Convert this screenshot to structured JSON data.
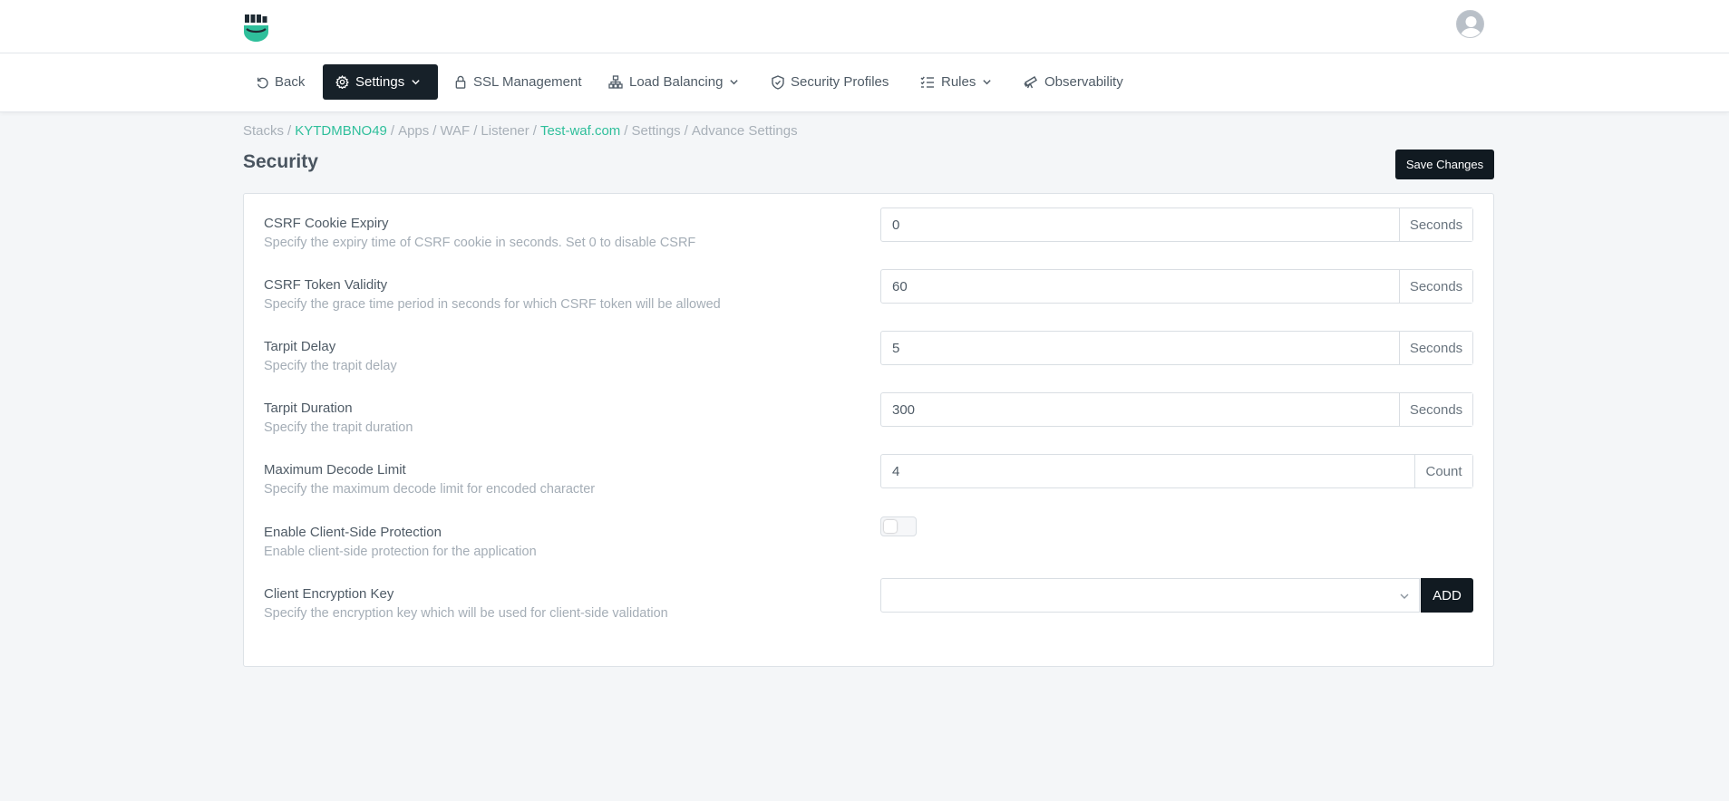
{
  "nav": {
    "items": [
      {
        "label": "Back",
        "icon": "undo-icon"
      },
      {
        "label": "Settings",
        "icon": "gear-icon",
        "active": true,
        "dropdown": true
      },
      {
        "label": "SSL Management",
        "icon": "lock-icon"
      },
      {
        "label": "Load Balancing",
        "icon": "network-icon",
        "dropdown": true
      },
      {
        "label": "Security Profiles",
        "icon": "shield-icon"
      },
      {
        "label": "Rules",
        "icon": "list-check-icon",
        "dropdown": true
      },
      {
        "label": "Observability",
        "icon": "telescope-icon"
      }
    ]
  },
  "breadcrumb": {
    "stacks": "Stacks",
    "stack_id": "KYTDMBNO49",
    "apps": "Apps",
    "waf": "WAF",
    "listener": "Listener",
    "domain": "Test-waf.com",
    "settings": "Settings",
    "current": "Advance Settings",
    "separator": "/"
  },
  "page": {
    "title": "Security",
    "save_label": "Save Changes"
  },
  "settings": [
    {
      "title": "CSRF Cookie Expiry",
      "desc": "Specify the expiry time of CSRF cookie in seconds. Set 0 to disable CSRF",
      "value": "0",
      "unit": "Seconds"
    },
    {
      "title": "CSRF Token Validity",
      "desc": "Specify the grace time period in seconds for which CSRF token will be allowed",
      "value": "60",
      "unit": "Seconds"
    },
    {
      "title": "Tarpit Delay",
      "desc": "Specify the trapit delay",
      "value": "5",
      "unit": "Seconds"
    },
    {
      "title": "Tarpit Duration",
      "desc": "Specify the trapit duration",
      "value": "300",
      "unit": "Seconds"
    },
    {
      "title": "Maximum Decode Limit",
      "desc": "Specify the maximum decode limit for encoded character",
      "value": "4",
      "unit": "Count"
    },
    {
      "title": "Enable Client-Side Protection",
      "desc": "Enable client-side protection for the application",
      "toggle": false
    },
    {
      "title": "Client Encryption Key",
      "desc": "Specify the encryption key which will be used for client-side validation",
      "select_value": "",
      "add_label": "ADD"
    }
  ],
  "colors": {
    "accent": "#2fbf9b",
    "dark": "#111a21",
    "background": "#f4f6f8"
  }
}
